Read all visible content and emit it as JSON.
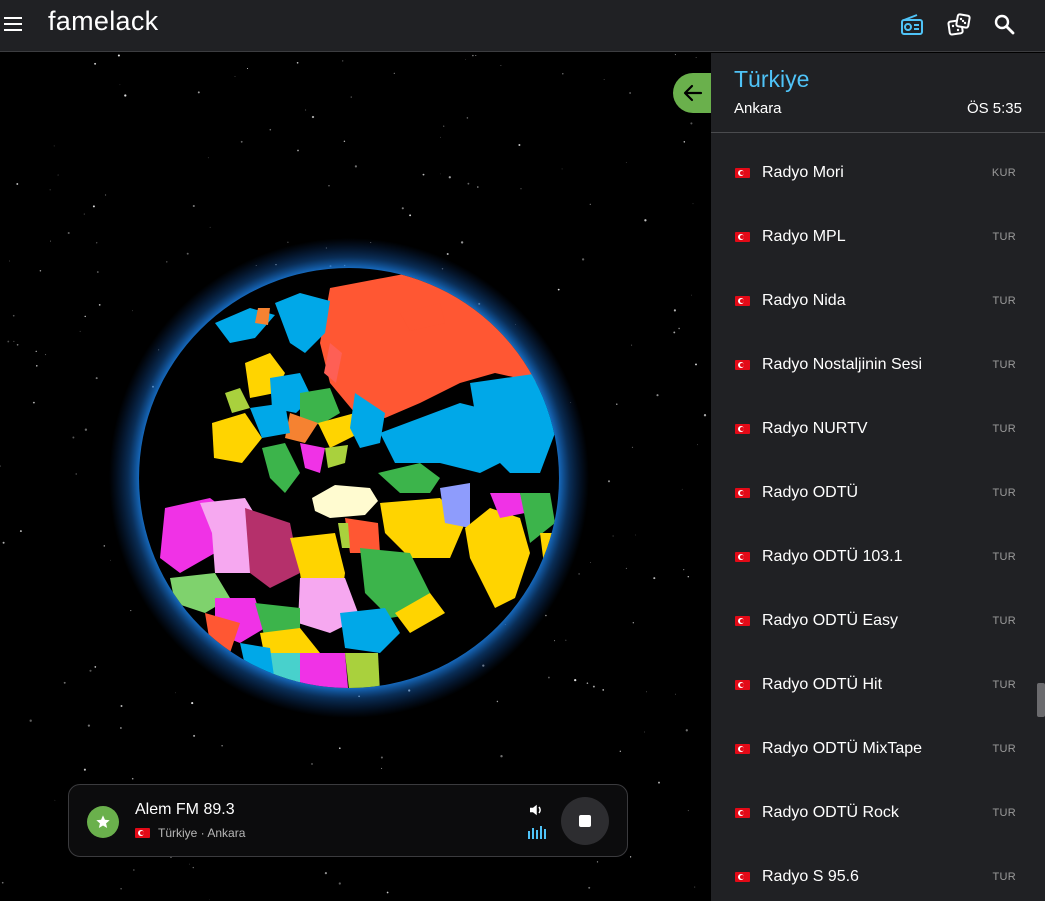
{
  "app": {
    "title": "famelack"
  },
  "header_icons": {
    "radio": "radio-icon",
    "dice": "dice-icon",
    "search": "search-icon"
  },
  "colors": {
    "accent_blue": "#4fc3f7",
    "accent_green": "#6ab04c",
    "panel_bg": "#202124",
    "highlight_country": "#fffbd0"
  },
  "panel": {
    "country": "Türkiye",
    "city": "Ankara",
    "time": "ÖS 5:35",
    "stations": [
      {
        "name": "Radyo Mori",
        "code": "KUR"
      },
      {
        "name": "Radyo MPL",
        "code": "TUR"
      },
      {
        "name": "Radyo Nida",
        "code": "TUR"
      },
      {
        "name": "Radyo Nostaljinin Sesi",
        "code": "TUR"
      },
      {
        "name": "Radyo NURTV",
        "code": "TUR"
      },
      {
        "name": "Radyo ODTÜ",
        "code": "TUR"
      },
      {
        "name": "Radyo ODTÜ 103.1",
        "code": "TUR"
      },
      {
        "name": "Radyo ODTÜ Easy",
        "code": "TUR"
      },
      {
        "name": "Radyo ODTÜ Hit",
        "code": "TUR"
      },
      {
        "name": "Radyo ODTÜ MixTape",
        "code": "TUR"
      },
      {
        "name": "Radyo ODTÜ Rock",
        "code": "TUR"
      },
      {
        "name": "Radyo S 95.6",
        "code": "TUR"
      }
    ]
  },
  "player": {
    "station": "Alem FM 89.3",
    "location": "Türkiye · Ankara"
  }
}
